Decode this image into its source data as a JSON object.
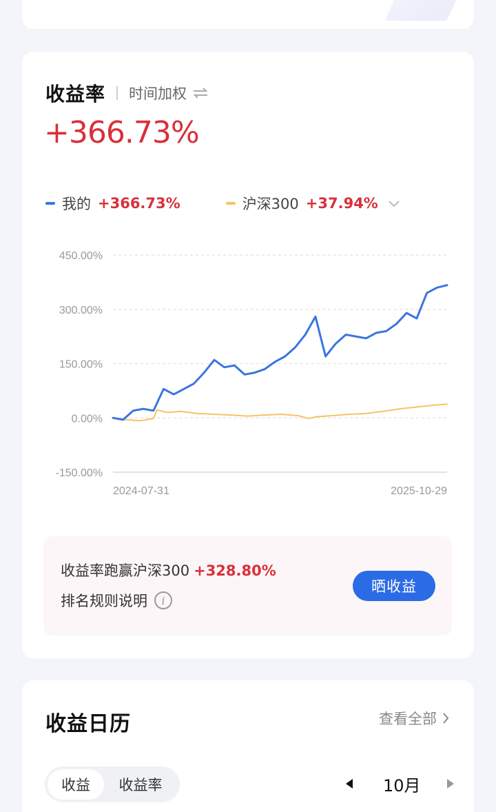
{
  "returns": {
    "title": "收益率",
    "mode_label": "时间加权",
    "total": "+366.73%",
    "legend": [
      {
        "name": "我的",
        "value": "+366.73%",
        "color": "#3a74e0"
      },
      {
        "name": "沪深300",
        "value": "+37.94%",
        "color": "#f5c462"
      }
    ],
    "promo": {
      "beat_label": "收益率跑赢沪深300",
      "beat_value": "+328.80%",
      "rule_label": "排名规则说明",
      "info_glyph": "i",
      "share_button": "晒收益"
    }
  },
  "chart_data": {
    "type": "line",
    "y_ticks": [
      "450.00%",
      "300.00%",
      "150.00%",
      "0.00%",
      "-150.00%"
    ],
    "ylim": [
      -150,
      450
    ],
    "x_labels": [
      "2024-07-31",
      "2025-10-29"
    ],
    "grid": true,
    "series": [
      {
        "name": "我的",
        "color": "#3a74e0",
        "x": [
          0,
          3,
          6,
          9,
          12,
          15,
          18,
          21,
          24,
          27,
          30,
          33,
          36,
          39,
          42,
          45,
          48,
          51,
          54,
          57,
          60,
          63,
          66,
          69,
          72,
          75,
          78,
          81,
          84,
          87,
          90,
          93,
          96,
          99
        ],
        "values": [
          0,
          -5,
          20,
          25,
          20,
          80,
          65,
          80,
          95,
          125,
          160,
          140,
          145,
          120,
          125,
          135,
          155,
          170,
          195,
          230,
          280,
          170,
          205,
          230,
          225,
          220,
          235,
          240,
          260,
          290,
          275,
          345,
          360,
          366.73
        ]
      },
      {
        "name": "沪深300",
        "color": "#f5c462",
        "x": [
          0,
          4,
          8,
          12,
          13,
          16,
          20,
          25,
          30,
          35,
          40,
          45,
          50,
          55,
          58,
          60,
          63,
          66,
          70,
          75,
          80,
          85,
          90,
          95,
          99
        ],
        "values": [
          0,
          -5,
          -8,
          -2,
          22,
          15,
          18,
          12,
          10,
          8,
          5,
          8,
          10,
          6,
          -2,
          3,
          5,
          7,
          10,
          12,
          18,
          25,
          30,
          35,
          37.94
        ]
      }
    ]
  },
  "calendar": {
    "title": "收益日历",
    "view_all": "查看全部",
    "tabs": [
      "收益",
      "收益率"
    ],
    "active_tab": 0,
    "month": "10月"
  }
}
